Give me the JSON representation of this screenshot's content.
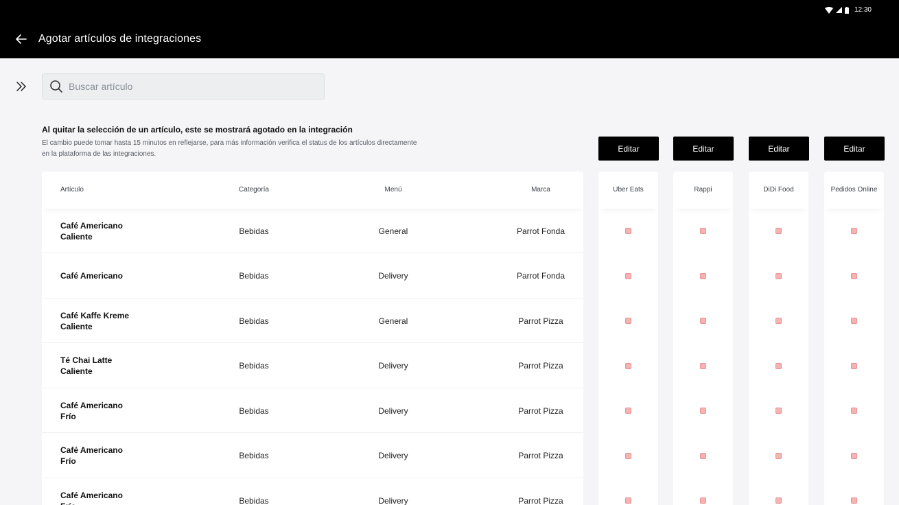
{
  "status_bar": {
    "time": "12:30"
  },
  "header": {
    "title": "Agotar artículos de integraciones"
  },
  "search": {
    "placeholder": "Buscar artículo",
    "value": ""
  },
  "notice": {
    "title": "Al quitar la selección de un artículo, este se mostrará agotado en la integración",
    "text": "El cambio puede tomar hasta 15 minutos en reflejarse, para más información verifica el status de los artículos directamente en la plataforma de las integraciones."
  },
  "table": {
    "columns": {
      "article": "Artículo",
      "category": "Categoría",
      "menu": "Menú",
      "brand": "Marca"
    },
    "rows": [
      {
        "name": "Café Americano Caliente",
        "category": "Bebidas",
        "menu": "General",
        "brand": "Parrot Fonda"
      },
      {
        "name": "Café Americano",
        "category": "Bebidas",
        "menu": "Delivery",
        "brand": "Parrot Fonda"
      },
      {
        "name": "Café Kaffe Kreme Caliente",
        "category": "Bebidas",
        "menu": "General",
        "brand": "Parrot Pizza"
      },
      {
        "name": "Té Chai Latte Caliente",
        "category": "Bebidas",
        "menu": "Delivery",
        "brand": "Parrot Pizza"
      },
      {
        "name": "Café Americano Frío",
        "category": "Bebidas",
        "menu": "Delivery",
        "brand": "Parrot Pizza"
      },
      {
        "name": "Café Americano Frío",
        "category": "Bebidas",
        "menu": "Delivery",
        "brand": "Parrot Pizza"
      },
      {
        "name": "Café Americano Frío",
        "category": "Bebidas",
        "menu": "Delivery",
        "brand": "Parrot Pizza"
      }
    ]
  },
  "integrations": [
    {
      "name": "Uber Eats",
      "edit_label": "Editar"
    },
    {
      "name": "Rappi",
      "edit_label": "Editar"
    },
    {
      "name": "DiDi Food",
      "edit_label": "Editar"
    },
    {
      "name": "Pedidos Online",
      "edit_label": "Editar"
    }
  ],
  "colors": {
    "header_bg": "#000000",
    "checkbox_fill": "#f6b3b4",
    "checkbox_border": "#eb8f91",
    "button_bg": "#000000"
  },
  "icons": {
    "back": "arrow-left-icon",
    "expand": "double-chevron-right-icon",
    "search": "search-icon"
  }
}
